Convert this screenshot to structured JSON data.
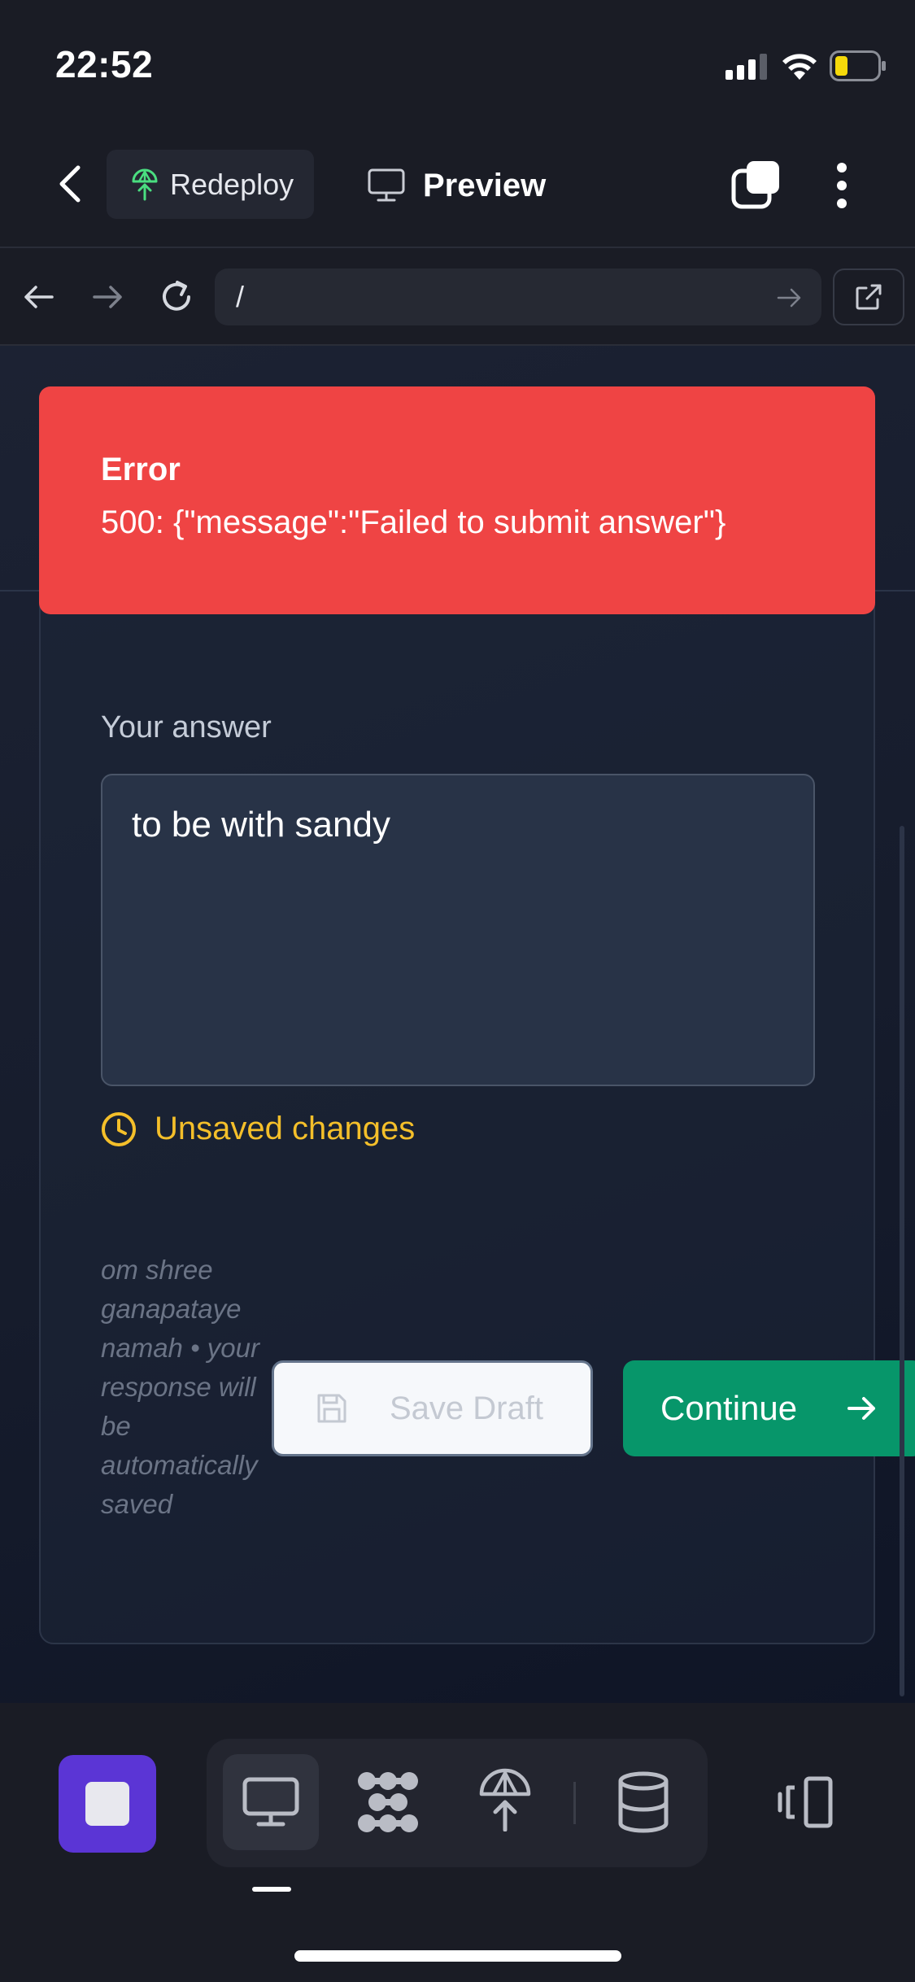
{
  "status_bar": {
    "time": "22:52"
  },
  "toolbar": {
    "redeploy_label": "Redeploy",
    "preview_label": "Preview"
  },
  "browser": {
    "url": "/"
  },
  "error": {
    "title": "Error",
    "message": "500: {\"message\":\"Failed to submit answer\"}"
  },
  "form": {
    "answer_label": "Your answer",
    "answer_value": "to be with sandy",
    "unsaved_text": "Unsaved changes",
    "note": "om shree ganapataye namah • your response will be automatically saved",
    "save_draft_label": "Save Draft",
    "continue_label": "Continue"
  },
  "dock": {
    "icons": [
      "stop-icon",
      "monitor-icon",
      "nodes-icon",
      "deploy-icon",
      "database-icon",
      "device-switch-icon"
    ]
  },
  "colors": {
    "error": "#ef4444",
    "continue": "#07966a",
    "unsaved": "#f4bf2a",
    "stop": "#5b35d5",
    "redeploy_icon": "#4ade80"
  }
}
